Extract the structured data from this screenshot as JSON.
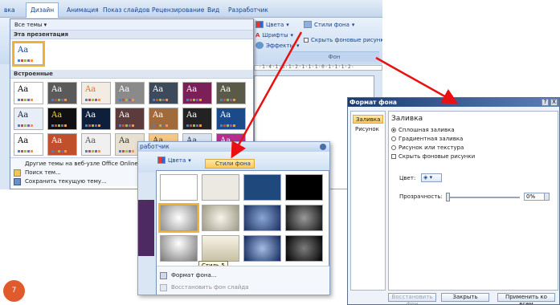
{
  "ribbon": {
    "tabs": [
      "вка",
      "Дизайн",
      "Анимация",
      "Показ слайдов",
      "Рецензирование",
      "Вид",
      "Разработчик"
    ],
    "active_tab": "Дизайн",
    "colors_label": "Цвета",
    "fonts_label": "Шрифты",
    "effects_label": "Эффекты",
    "bg_styles_label": "Стили фона",
    "hide_bg_label": "Скрыть фоновые рисунки",
    "group_label": "Фон",
    "ruler_text": "·1·4·1·3·1·2·1·1·1·0·1·1·1·2·"
  },
  "theme_gallery": {
    "filter_label": "Все темы",
    "section_this": "Эта презентация",
    "section_builtin": "Встроенные",
    "thumb_text": "Aa",
    "menu": [
      "Другие темы на веб-узле Office Online...",
      "Поиск тем...",
      "Сохранить текущую тему..."
    ]
  },
  "bg_panel": {
    "title_fragment": "работчик",
    "colors_label": "Цвета",
    "styles_label": "Стили фона",
    "tooltip": "Стиль 5",
    "menu": [
      "Формат фона...",
      "Восстановить фон слайда"
    ],
    "ruler_text": "2·1·"
  },
  "dialog": {
    "title": "Формат фона",
    "help_btn": "?",
    "close_btn": "X",
    "nav": [
      "Заливка",
      "Рисунок"
    ],
    "heading": "Заливка",
    "options": [
      "Сплошная заливка",
      "Градиентная заливка",
      "Рисунок или текстура",
      "Скрыть фоновые рисунки"
    ],
    "color_label": "Цвет:",
    "transparency_label": "Прозрачность:",
    "transparency_value": "0%",
    "buttons": [
      "Восстановить фон",
      "Закрыть",
      "Применить ко всем"
    ]
  },
  "page_number": "7",
  "colors": {
    "accent_orange": "#e15a2d",
    "arrow_red": "#e81010",
    "highlight": "#ffc85a"
  }
}
